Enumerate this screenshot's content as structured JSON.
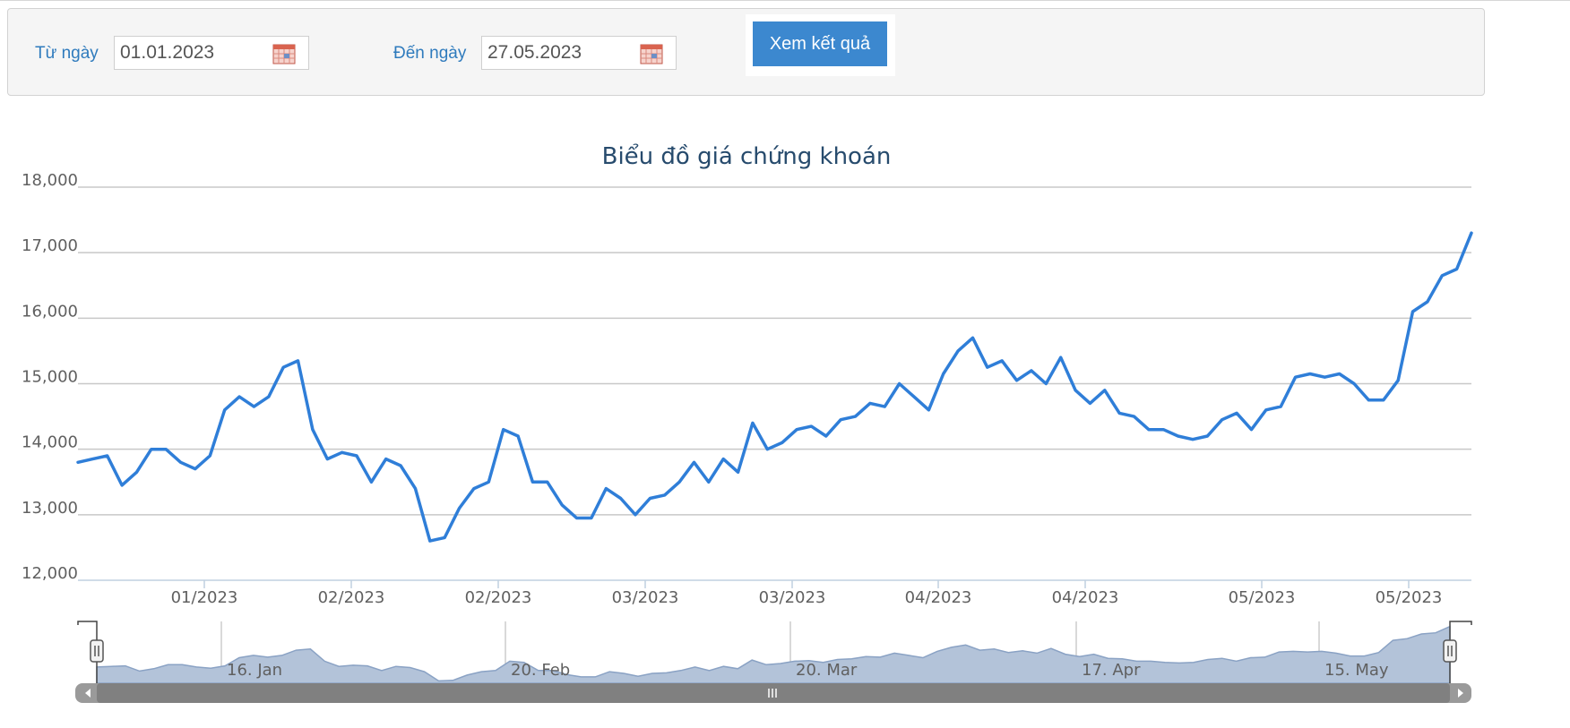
{
  "filter": {
    "from_label": "Từ ngày",
    "from_value": "01.01.2023",
    "to_label": "Đến ngày",
    "to_value": "27.05.2023",
    "submit_label": "Xem kết quả"
  },
  "colors": {
    "accent": "#3c88cf",
    "label": "#2f7bbd",
    "line": "#2f7ed8",
    "navigator_fill": "#b3c3d9",
    "navigator_line": "#8aa2c4",
    "scrollbar": "#808080"
  },
  "icons": {
    "calendar": "calendar-icon",
    "scroll_left": "arrow-left-icon",
    "scroll_right": "arrow-right-icon",
    "grip": "grip-icon",
    "handle": "handle-icon"
  },
  "chart_data": {
    "type": "line",
    "title": "Biểu đồ giá chứng khoán",
    "xlabel": "",
    "ylabel": "",
    "ylim": [
      12000,
      18000
    ],
    "y_ticks": [
      "12,000",
      "13,000",
      "14,000",
      "15,000",
      "16,000",
      "17,000",
      "18,000"
    ],
    "grid": true,
    "x_tick_labels": [
      "01/2023",
      "02/2023",
      "02/2023",
      "03/2023",
      "03/2023",
      "04/2023",
      "04/2023",
      "05/2023",
      "05/2023"
    ],
    "navigator_labels": [
      "16. Jan",
      "20. Feb",
      "20. Mar",
      "17. Apr",
      "15. May"
    ],
    "series": [
      {
        "values": [
          13800,
          13850,
          13900,
          13450,
          13650,
          14000,
          14000,
          13800,
          13700,
          13900,
          14600,
          14800,
          14650,
          14800,
          15250,
          15350,
          14300,
          13850,
          13950,
          13900,
          13500,
          13850,
          13750,
          13400,
          12600,
          12650,
          13100,
          13400,
          13500,
          14300,
          14200,
          13500,
          13500,
          13150,
          12950,
          12950,
          13400,
          13250,
          13000,
          13250,
          13300,
          13500,
          13800,
          13500,
          13850,
          13650,
          14400,
          14000,
          14100,
          14300,
          14350,
          14200,
          14450,
          14500,
          14700,
          14650,
          15000,
          14800,
          14600,
          15150,
          15500,
          15700,
          15250,
          15350,
          15050,
          15200,
          15000,
          15400,
          14900,
          14700,
          14900,
          14550,
          14500,
          14300,
          14300,
          14200,
          14150,
          14200,
          14450,
          14550,
          14300,
          14600,
          14650,
          15100,
          15150,
          15100,
          15150,
          15000,
          14750,
          14750,
          15050,
          16100,
          16250,
          16650,
          16750,
          17300
        ]
      }
    ]
  }
}
